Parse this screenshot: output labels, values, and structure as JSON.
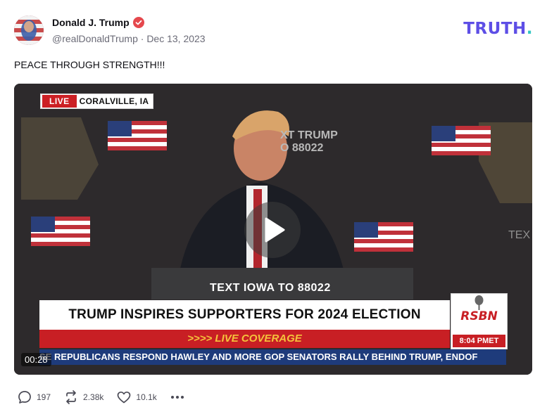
{
  "post": {
    "author_name": "Donald J. Trump",
    "handle": "@realDonaldTrump",
    "separator": "·",
    "date": "Dec 13, 2023",
    "text": "PEACE THROUGH STRENGTH!!!"
  },
  "brand": {
    "logo_text": "TRUTH",
    "logo_dot": ".",
    "primary_color": "#5d4ee6",
    "dot_color": "#33c7c3"
  },
  "video": {
    "live_label": "LIVE",
    "location": "CORALVILLE, IA",
    "backdrop_text_line1": "XT TRUMP",
    "backdrop_text_line2": "O 88022",
    "right_backdrop_text": "TEX",
    "podium_text": "TEXT IOWA TO 88022",
    "headline": "TRUMP INSPIRES SUPPORTERS FOR 2024 ELECTION",
    "live_coverage": "LIVE COVERAGE",
    "arrows": ">>>>",
    "ticker": "SE REPUBLICANS RESPOND    HAWLEY AND MORE GOP SENATORS RALLY BEHIND TRUMP, ENDOF",
    "network_logo": "RSBN",
    "network_time": "8:04 PMET",
    "timestamp": "00:28",
    "play_icon": "play-icon"
  },
  "actions": {
    "replies": "197",
    "retruths": "2.38k",
    "likes": "10.1k",
    "more": "more-icon"
  }
}
